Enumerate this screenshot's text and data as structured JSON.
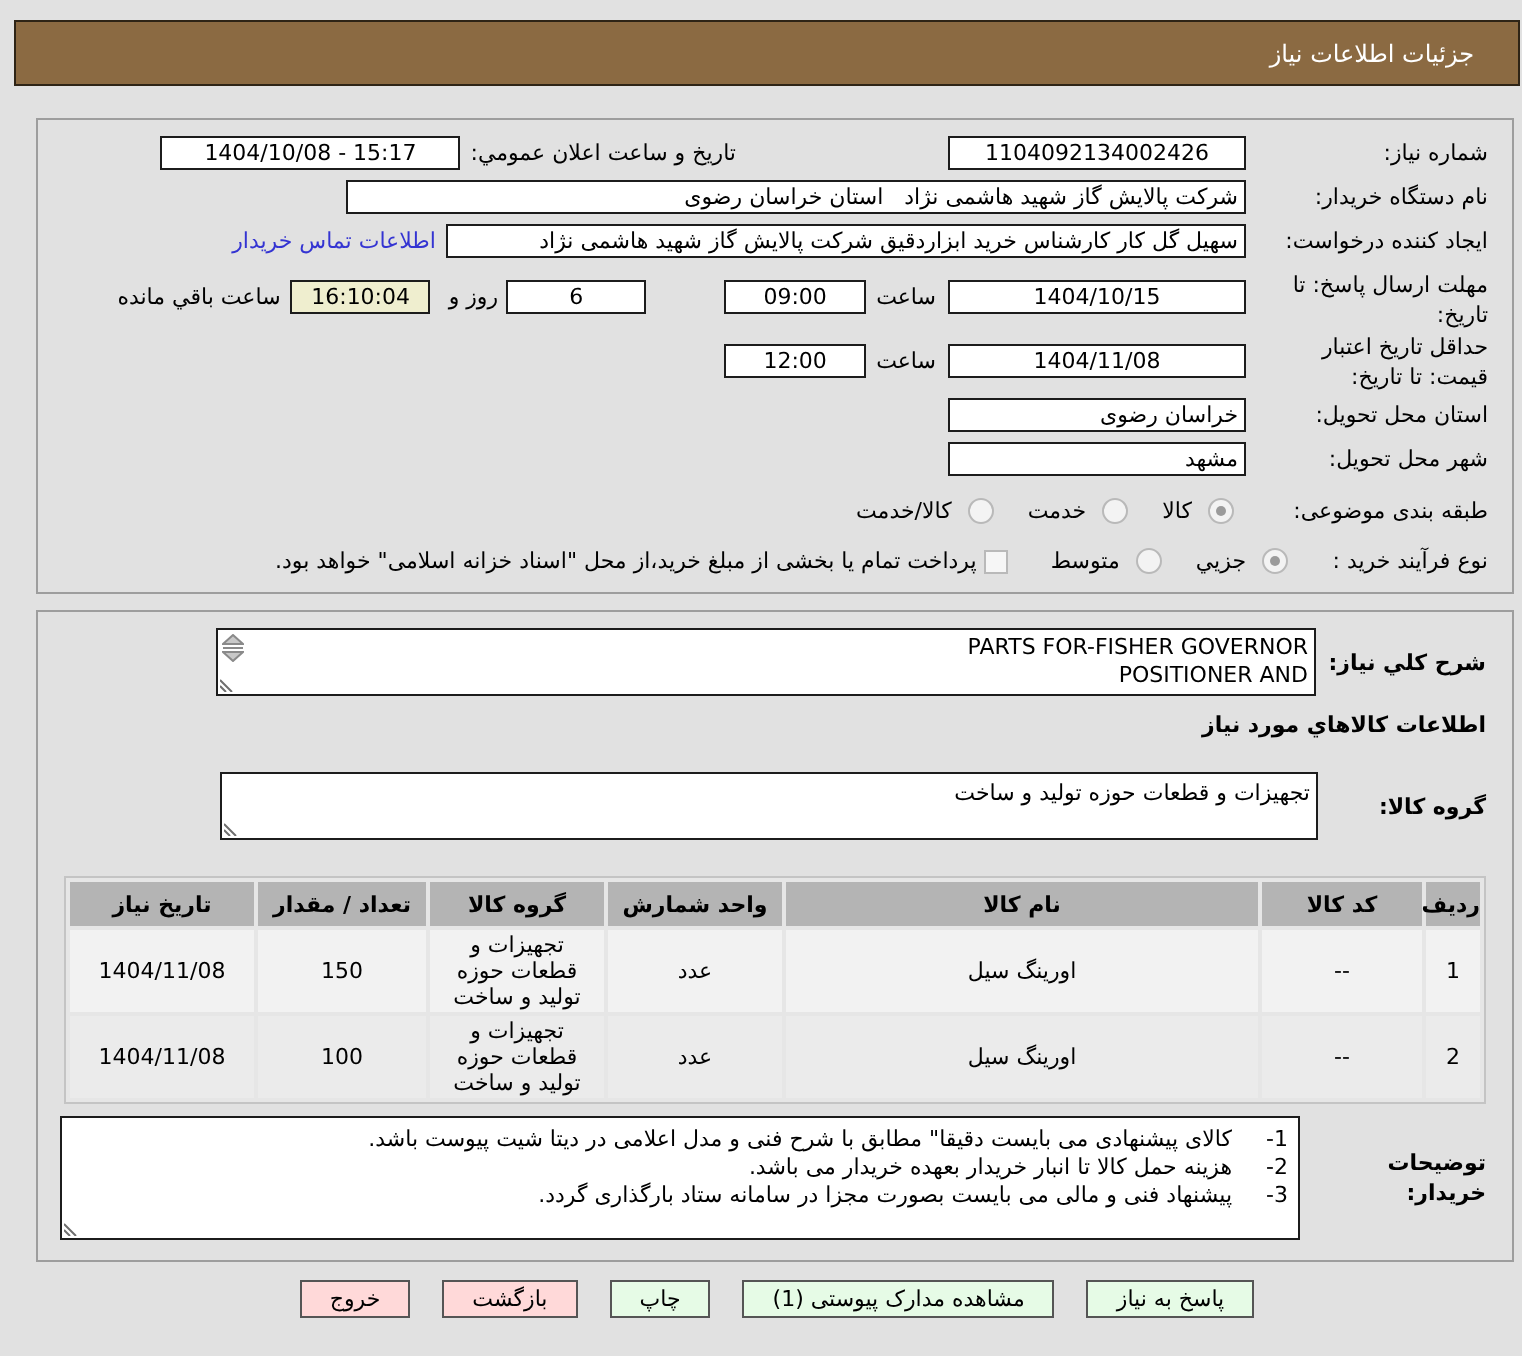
{
  "window": {
    "title": "جزئیات اطلاعات نیاز"
  },
  "need_info": {
    "need_number": {
      "label": "شماره نیاز:",
      "value": "1104092134002426"
    },
    "announcement": {
      "label": "تاریخ و ساعت اعلان عمومي:",
      "value": "1404/10/08 - 15:17"
    },
    "buyer": {
      "label": "نام دستگاه خریدار:",
      "value": "شرکت پالایش گاز شهید هاشمی نژاد   استان خراسان رضوی"
    },
    "requester": {
      "label": "ایجاد کننده درخواست:",
      "value": "سهیل گل کار کارشناس خرید ابزاردقیق شرکت پالایش گاز شهید هاشمی نژاد",
      "contact_link": "اطلاعات تماس خریدار"
    },
    "reply_deadline": {
      "label": "مهلت ارسال پاسخ: تا تاریخ:",
      "date": "1404/10/15",
      "time_label": "ساعت",
      "time": "09:00",
      "days": "6",
      "days_label": "روز و",
      "remaining": "16:10:04",
      "remaining_label": "ساعت باقي مانده"
    },
    "price_validity": {
      "label": "حداقل تاریخ اعتبار قیمت: تا تاریخ:",
      "date": "1404/11/08",
      "time_label": "ساعت",
      "time": "12:00"
    },
    "delivery_province": {
      "label": "استان محل تحویل:",
      "value": "خراسان رضوی"
    },
    "delivery_city": {
      "label": "شهر محل تحویل:",
      "value": "مشهد"
    },
    "category": {
      "label": "طبقه بندی موضوعی:",
      "options": [
        {
          "label": "کالا",
          "selected": true
        },
        {
          "label": "خدمت",
          "selected": false
        },
        {
          "label": "کالا/خدمت",
          "selected": false
        }
      ]
    },
    "purchase_process": {
      "label": "نوع فرآیند خرید :",
      "options": [
        {
          "label": "جزيي",
          "selected": true
        },
        {
          "label": "متوسط",
          "selected": false
        }
      ],
      "treasury_payment": {
        "label": "پرداخت تمام یا بخشی از مبلغ خرید،از محل \"اسناد خزانه اسلامی\" خواهد بود.",
        "checked": false
      }
    }
  },
  "goods": {
    "description": {
      "label": "شرح کلي نیاز:",
      "value": "PARTS FOR-FISHER GOVERNOR\nPOSITIONER AND"
    },
    "heading": "اطلاعات کالاهاي مورد نیاز",
    "group": {
      "label": "گروه کالا:",
      "value": "تجهیزات و قطعات حوزه تولید و ساخت"
    },
    "table": {
      "columns": [
        "ردیف",
        "کد کالا",
        "نام کالا",
        "واحد شمارش",
        "گروه کالا",
        "تعداد / مقدار",
        "تاریخ نیاز"
      ],
      "rows": [
        [
          "1",
          "--",
          "اورینگ سیل",
          "عدد",
          "تجهیزات و قطعات حوزه تولید و ساخت",
          "150",
          "1404/11/08"
        ],
        [
          "2",
          "--",
          "اورینگ سیل",
          "عدد",
          "تجهیزات و قطعات حوزه تولید و ساخت",
          "100",
          "1404/11/08"
        ]
      ]
    },
    "buyer_notes": {
      "label": "توضیحات خریدار:",
      "lines": [
        {
          "number": "1-",
          "text": "کالای پیشنهادی می بایست دقیقا\" مطابق با شرح فنی و مدل اعلامی در دیتا شیت پیوست باشد."
        },
        {
          "number": "2-",
          "text": "هزینه حمل کالا تا انبار خریدار بعهده خریدار می باشد."
        },
        {
          "number": "3-",
          "text": "پیشنهاد فنی و مالی می بایست بصورت مجزا در سامانه ستاد بارگذاری گردد."
        }
      ]
    }
  },
  "buttons": [
    {
      "label": "پاسخ به نیاز",
      "kind": "proceed"
    },
    {
      "label": "مشاهده مدارک پیوستی (1)",
      "kind": "proceed"
    },
    {
      "label": "چاپ",
      "kind": "proceed"
    },
    {
      "label": "بازگشت",
      "kind": "leave"
    },
    {
      "label": "خروج",
      "kind": "leave"
    }
  ]
}
